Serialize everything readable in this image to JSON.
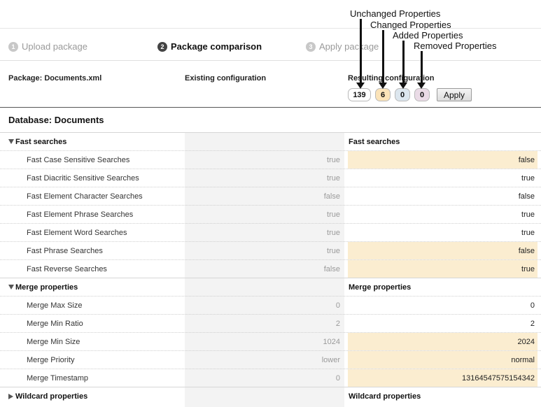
{
  "annotations": {
    "unchanged": "Unchanged Properties",
    "changed": "Changed Properties",
    "added": "Added Properties",
    "removed": "Removed Properties"
  },
  "steps": [
    {
      "num": "1",
      "label": "Upload package",
      "state": "inactive"
    },
    {
      "num": "2",
      "label": "Package comparison",
      "state": "active"
    },
    {
      "num": "3",
      "label": "Apply package",
      "state": "inactive"
    }
  ],
  "header": {
    "package": "Package: Documents.xml",
    "existing": "Existing configuration",
    "resulting": "Resulting configuration"
  },
  "counts": {
    "unchanged": "139",
    "changed": "6",
    "added": "0",
    "removed": "0"
  },
  "apply_label": "Apply",
  "database_title": "Database: Documents",
  "groups": {
    "fast": {
      "label": "Fast searches",
      "right": "Fast searches"
    },
    "merge": {
      "label": "Merge properties",
      "right": "Merge properties"
    },
    "wildcard": {
      "label": "Wildcard properties",
      "right": "Wildcard properties"
    }
  },
  "rows": [
    {
      "name": "Fast Case Sensitive Searches",
      "old": "true",
      "new": "false",
      "changed": true
    },
    {
      "name": "Fast Diacritic Sensitive Searches",
      "old": "true",
      "new": "true",
      "changed": false
    },
    {
      "name": "Fast Element Character Searches",
      "old": "false",
      "new": "false",
      "changed": false
    },
    {
      "name": "Fast Element Phrase Searches",
      "old": "true",
      "new": "true",
      "changed": false
    },
    {
      "name": "Fast Element Word Searches",
      "old": "true",
      "new": "true",
      "changed": false
    },
    {
      "name": "Fast Phrase Searches",
      "old": "true",
      "new": "false",
      "changed": true
    },
    {
      "name": "Fast Reverse Searches",
      "old": "false",
      "new": "true",
      "changed": true
    },
    {
      "name": "Merge Max Size",
      "old": "0",
      "new": "0",
      "changed": false
    },
    {
      "name": "Merge Min Ratio",
      "old": "2",
      "new": "2",
      "changed": false
    },
    {
      "name": "Merge Min Size",
      "old": "1024",
      "new": "2024",
      "changed": true
    },
    {
      "name": "Merge Priority",
      "old": "lower",
      "new": "normal",
      "changed": true
    },
    {
      "name": "Merge Timestamp",
      "old": "0",
      "new": "13164547575154342",
      "changed": true
    }
  ],
  "colors": {
    "changed": "#fbedd0",
    "changed_badge": "#fbe3b8",
    "added_badge": "#dce6ee",
    "removed_badge": "#eadbe6"
  }
}
